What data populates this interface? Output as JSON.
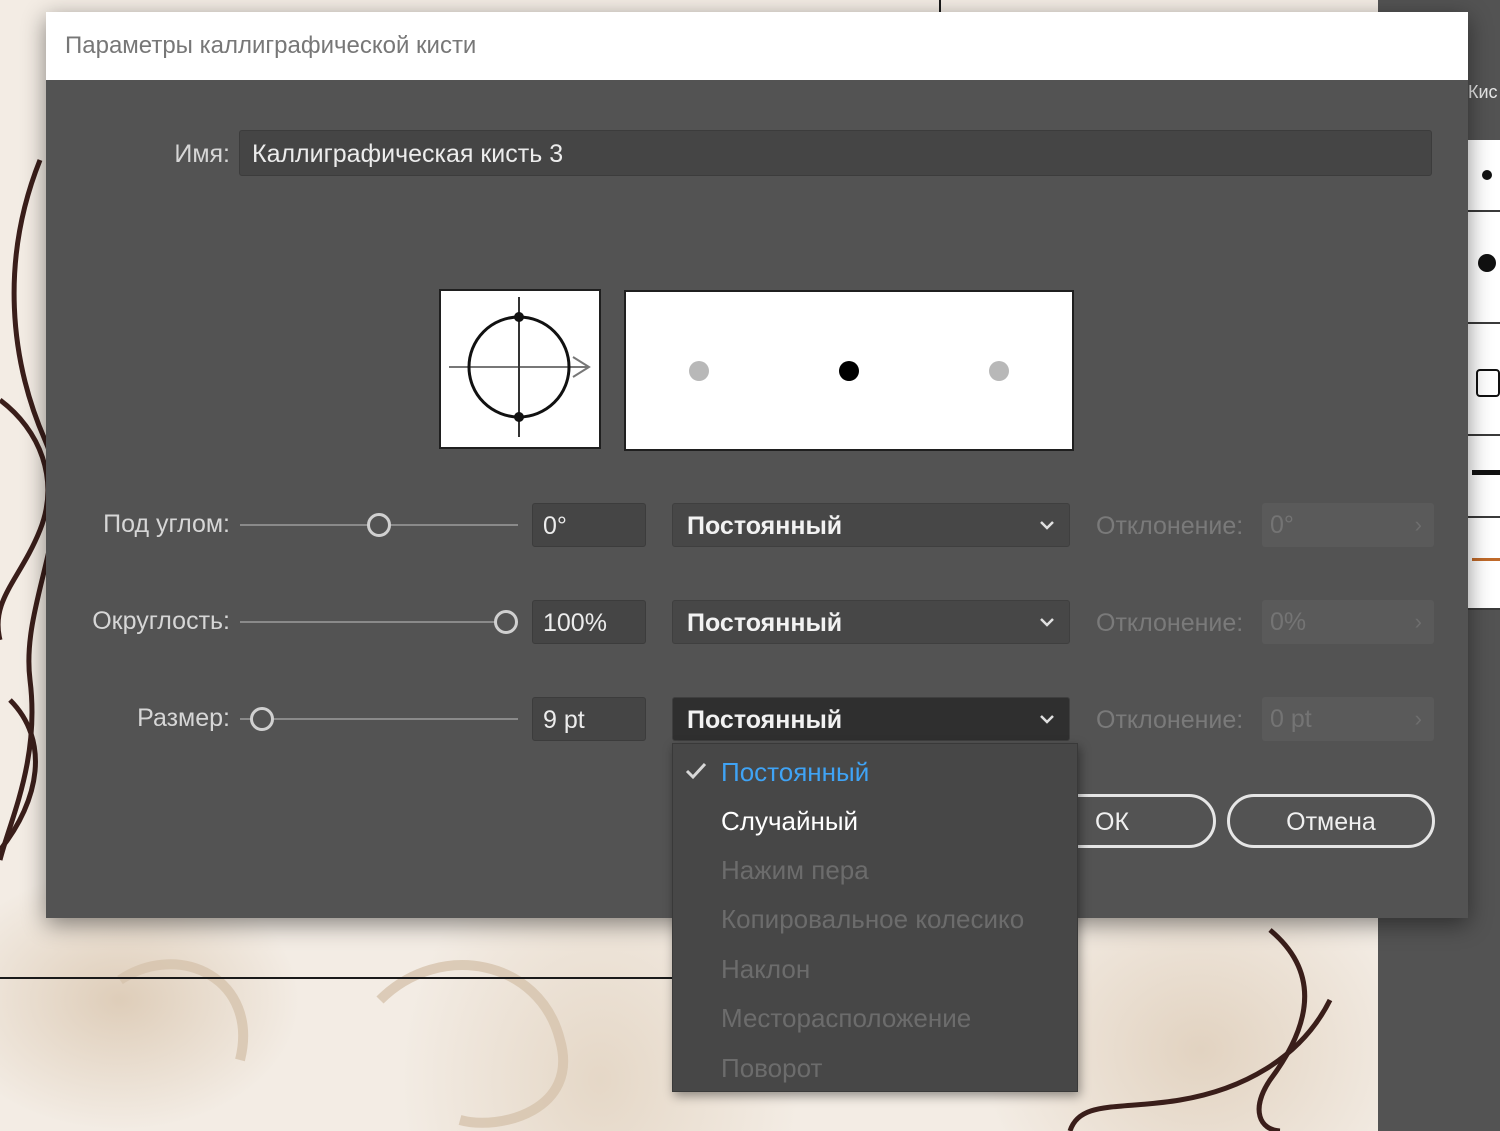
{
  "dialog": {
    "title": "Параметры каллиграфической кисти",
    "name_label": "Имя:",
    "name_value": "Каллиграфическая кисть 3"
  },
  "rows": [
    {
      "label": "Под углом:",
      "value": "0°",
      "slider_fraction": 0.5,
      "mode": "Постоянный",
      "deviation_label": "Отклонение:",
      "deviation_value": "0°"
    },
    {
      "label": "Округлость:",
      "value": "100%",
      "slider_fraction": 1.0,
      "mode": "Постоянный",
      "deviation_label": "Отклонение:",
      "deviation_value": "0%"
    },
    {
      "label": "Размер:",
      "value": "9 pt",
      "slider_fraction": 0.0,
      "mode": "Постоянный",
      "deviation_label": "Отклонение:",
      "deviation_value": "0 pt"
    }
  ],
  "buttons": {
    "ok": "ОК",
    "cancel": "Отмена"
  },
  "menu": {
    "items": [
      {
        "label": "Постоянный",
        "state": "selected"
      },
      {
        "label": "Случайный",
        "state": "enabled"
      },
      {
        "label": "Нажим пера",
        "state": "disabled"
      },
      {
        "label": "Копировальное колесико",
        "state": "disabled"
      },
      {
        "label": "Наклон",
        "state": "disabled"
      },
      {
        "label": "Месторасположение",
        "state": "disabled"
      },
      {
        "label": "Поворот",
        "state": "disabled"
      }
    ]
  },
  "side_panel": {
    "tab_label": "Кис"
  },
  "colors": {
    "dialog_bg": "#535353",
    "selected_item": "#3fa3f5"
  },
  "icons": {
    "check": "checkmark-icon",
    "chevron": "chevron-down-icon",
    "deviation_arrow": "chevron-right-icon"
  }
}
